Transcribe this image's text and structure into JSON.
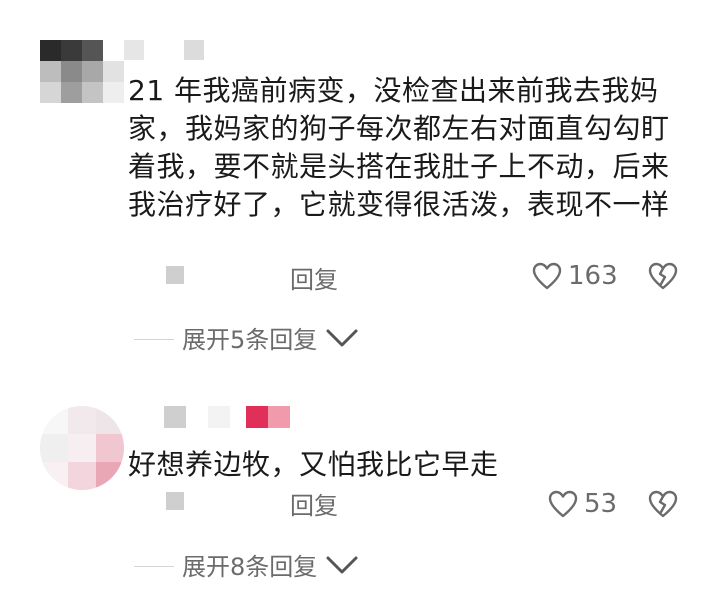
{
  "comments": [
    {
      "text": "21 年我癌前病变，没检查出来前我去我妈家，我妈家的狗子每次都左右对面直勾勾盯着我，要不就是头搭在我肚子上不动，后来我治疗好了，它就变得很活泼，表现不一样",
      "reply_label": "回复",
      "like_count": "163",
      "expand_label": "展开5条回复",
      "like_icon": "heart-outline-icon",
      "dislike_icon": "broken-heart-icon",
      "expand_icon": "chevron-down-icon"
    },
    {
      "text": "好想养边牧，又怕我比它早走",
      "reply_label": "回复",
      "like_count": "53",
      "expand_label": "展开8条回复",
      "like_icon": "heart-outline-icon",
      "dislike_icon": "broken-heart-icon",
      "expand_icon": "chevron-down-icon"
    }
  ],
  "colors": {
    "text": "#1a1a1a",
    "secondary": "#6b6b6b",
    "pixel_red": "#e0305a",
    "pixel_pink": "#f09aac"
  }
}
